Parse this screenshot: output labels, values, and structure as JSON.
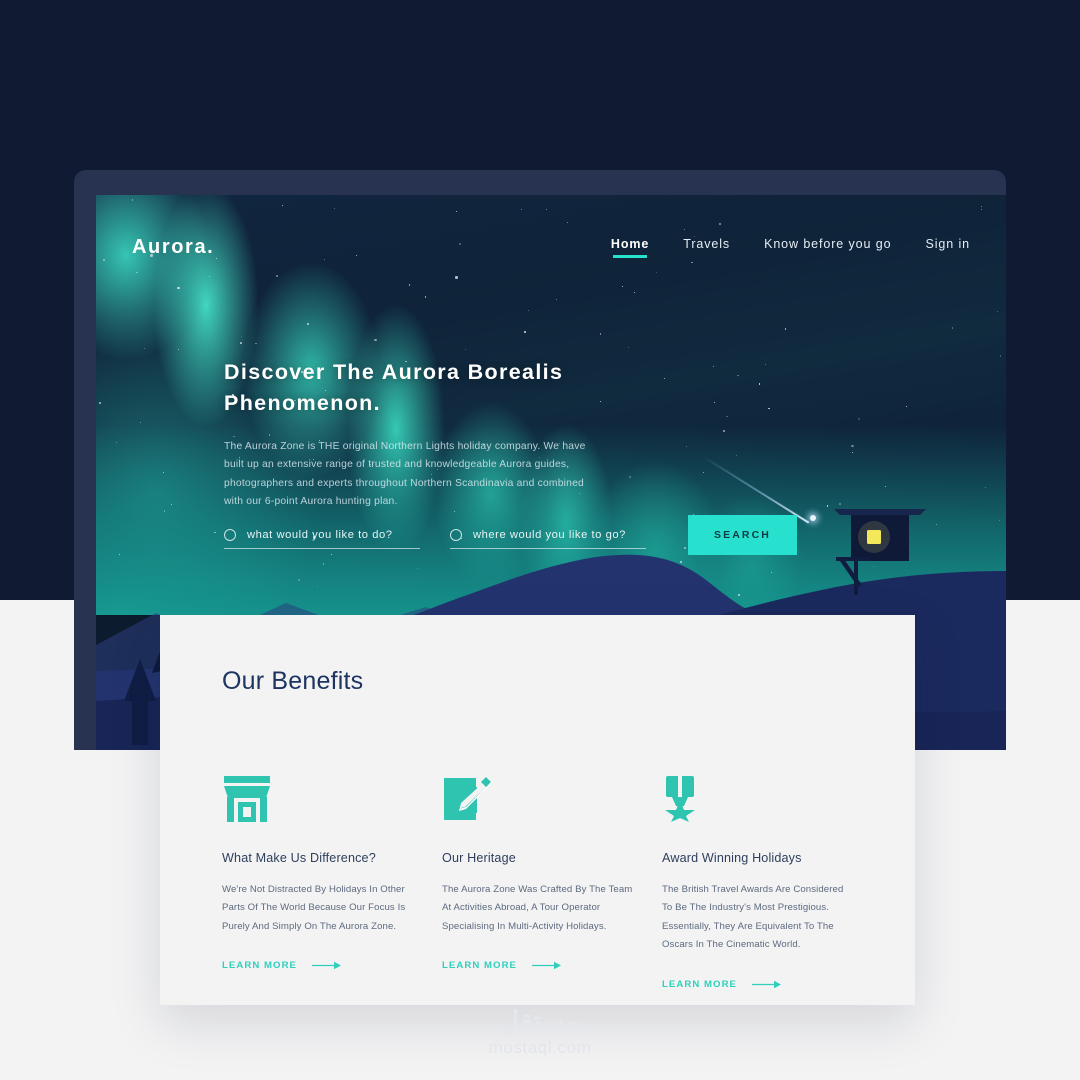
{
  "colors": {
    "page_dark": "#101b33",
    "page_light": "#f3f3f4",
    "device_frame": "#273350",
    "accent_teal": "#27e0ce",
    "link_teal": "#2fcfbc",
    "heading_navy": "#1d3461",
    "mountain_blue": "#23336e",
    "window_glow": "#f2e85a"
  },
  "nav": {
    "brand": "Aurora.",
    "links": [
      {
        "label": "Home",
        "active": true
      },
      {
        "label": "Travels",
        "active": false
      },
      {
        "label": "Know before you go",
        "active": false
      },
      {
        "label": "Sign in",
        "active": false
      }
    ]
  },
  "hero": {
    "title": "Discover The Aurora Borealis Phenomenon.",
    "subtitle": "The Aurora Zone is THE original Northern Lights holiday company. We have built up an extensive range of trusted and knowledgeable Aurora guides, photographers and experts throughout Northern Scandinavia and combined with our 6-point Aurora hunting plan."
  },
  "search": {
    "field_what_placeholder": "what would you like to do?",
    "field_what_value": "",
    "field_where_placeholder": "where would you like to go?",
    "field_where_value": "",
    "button_label": "SEARCH"
  },
  "benefits": {
    "title": "Our Benefits",
    "link_label": "LEARN MORE",
    "cards": [
      {
        "icon": "storefront-icon",
        "heading": "What Make Us Difference?",
        "body": "We're Not Distracted By Holidays In Other Parts Of The World Because Our Focus Is Purely And Simply On The Aurora Zone."
      },
      {
        "icon": "pen-write-icon",
        "heading": "Our Heritage",
        "body": "The Aurora Zone Was Crafted By The Team At Activities Abroad, A Tour Operator Specialising In Multi-Activity Holidays."
      },
      {
        "icon": "award-medal-icon",
        "heading": "Award Winning Holidays",
        "body": "The British Travel Awards Are Considered To Be The Industry's Most Prestigious. Essentially, They Are Equivalent To The Oscars In The Cinematic World."
      }
    ]
  },
  "watermark": {
    "arabic": "مستقل",
    "latin": "mostaql.com"
  }
}
